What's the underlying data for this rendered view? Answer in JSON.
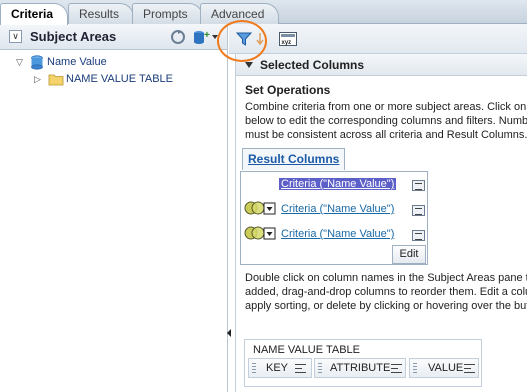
{
  "tabs": [
    {
      "label": "Criteria",
      "active": true
    },
    {
      "label": "Results",
      "active": false
    },
    {
      "label": "Prompts",
      "active": false
    },
    {
      "label": "Advanced",
      "active": false
    }
  ],
  "left_panel": {
    "title": "Subject Areas",
    "tree": [
      {
        "label": "Name Value",
        "expanded": true,
        "icon": "cylinder-icon"
      },
      {
        "label": "NAME VALUE TABLE",
        "expanded": false,
        "icon": "folder-icon"
      }
    ]
  },
  "toolbar": {
    "icons": [
      "filter-icon",
      "sort-icon",
      "xyz-icon"
    ]
  },
  "selected_columns": {
    "title": "Selected Columns",
    "set_operations_title": "Set Operations",
    "desc_lines": [
      "Combine criteria from one or more subject areas. Click on the",
      "below to edit the corresponding columns and filters. Numbe",
      "must be consistent across all criteria and Result Columns."
    ],
    "result_columns_label": "Result Columns",
    "criteria_rows": [
      {
        "label": "Criteria (\"Name Value\")",
        "selected": true
      },
      {
        "label": "Criteria (\"Name Value\")",
        "selected": false
      },
      {
        "label": "Criteria (\"Name Value\")",
        "selected": false
      }
    ],
    "edit_label": "Edit",
    "help_lines": [
      "Double click on column names in the Subject Areas pane to",
      "added, drag-and-drop columns to reorder them. Edit a colu",
      "apply sorting, or delete by clicking or hovering over the but"
    ],
    "table": {
      "title": "NAME VALUE TABLE",
      "columns": [
        "KEY",
        "ATTRIBUTE",
        "VALUE"
      ]
    }
  },
  "colors": {
    "accent_orange": "#f07a1c",
    "selected_bg": "#5c5fc8",
    "link": "#1a6aa6"
  }
}
